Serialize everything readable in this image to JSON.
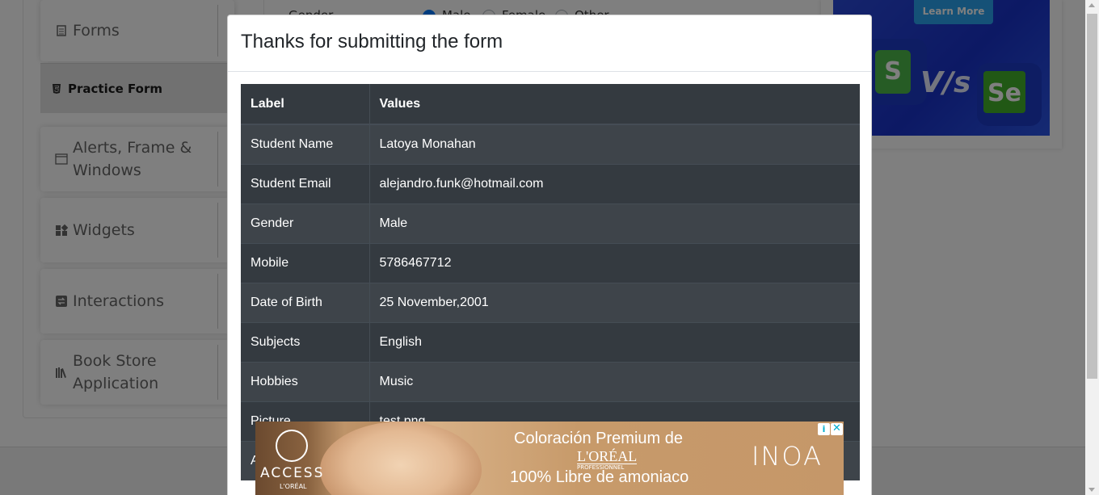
{
  "sidebar": {
    "groups": [
      {
        "label": "Forms",
        "icon": "form-icon"
      },
      {
        "label": "Alerts, Frame & Windows",
        "icon": "window-icon"
      },
      {
        "label": "Widgets",
        "icon": "widgets-icon"
      },
      {
        "label": "Interactions",
        "icon": "interactions-icon"
      },
      {
        "label": "Book Store Application",
        "icon": "books-icon"
      }
    ],
    "active_item": "Practice Form"
  },
  "form_bg": {
    "gender_label": "Gender",
    "options": [
      "Male",
      "Female",
      "Other"
    ]
  },
  "side_ad": {
    "button": "Learn More",
    "vs": "V/s",
    "se": "Se"
  },
  "modal": {
    "title": "Thanks for submitting the form",
    "columns": [
      "Label",
      "Values"
    ],
    "rows": [
      {
        "label": "Student Name",
        "value": "Latoya Monahan"
      },
      {
        "label": "Student Email",
        "value": "alejandro.funk@hotmail.com"
      },
      {
        "label": "Gender",
        "value": "Male"
      },
      {
        "label": "Mobile",
        "value": "5786467712"
      },
      {
        "label": "Date of Birth",
        "value": "25 November,2001"
      },
      {
        "label": "Subjects",
        "value": "English"
      },
      {
        "label": "Hobbies",
        "value": "Music"
      },
      {
        "label": "Picture",
        "value": "test.png"
      },
      {
        "label": "A",
        "value": ""
      }
    ]
  },
  "ad_banner": {
    "brand_access": "ACCESS",
    "brand_small": "L'ORÉAL",
    "headline": "Coloración Premium de",
    "brand_loreal": "L'ORÉAL",
    "brand_professionnel": "PROFESSIONNEL",
    "brand_paris": "PARIS",
    "subline": "100% Libre de amoniaco",
    "product": "INOA",
    "choices_glyph": "i",
    "close_glyph": "✕"
  }
}
